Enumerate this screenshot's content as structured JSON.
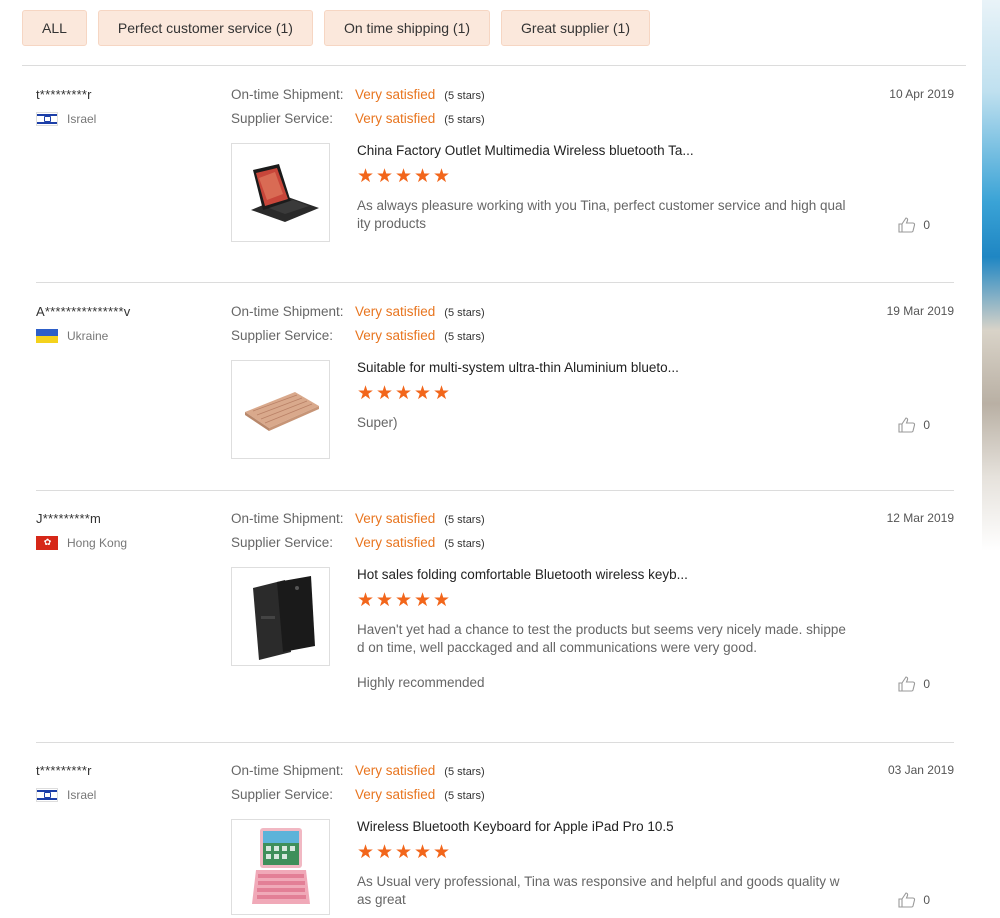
{
  "filters": [
    {
      "label": "ALL"
    },
    {
      "label": "Perfect customer service (1)"
    },
    {
      "label": "On time shipping (1)"
    },
    {
      "label": "Great supplier (1)"
    }
  ],
  "rating_labels": {
    "shipment": "On-time Shipment:",
    "service": "Supplier Service:"
  },
  "colors": {
    "accent": "#e8751f",
    "stars": "#f2661b",
    "filter_bg": "#fbe8dc"
  },
  "reviews": [
    {
      "buyer": "t*********r",
      "country": "Israel",
      "flag": "israel-flag",
      "date": "10 Apr 2019",
      "shipment_value": "Very satisfied",
      "shipment_stars": "(5 stars)",
      "service_value": "Very satisfied",
      "service_stars": "(5 stars)",
      "product_title": "China Factory Outlet Multimedia Wireless bluetooth Ta...",
      "product_image": "tablet-keyboard-case-icon",
      "rating": 5,
      "comment": "As always pleasure working with you Tina, perfect customer service and high quality  products",
      "comment_extra": "",
      "likes": "0"
    },
    {
      "buyer": "A***************v",
      "country": "Ukraine",
      "flag": "ukraine-flag",
      "date": "19 Mar 2019",
      "shipment_value": "Very satisfied",
      "shipment_stars": "(5 stars)",
      "service_value": "Very satisfied",
      "service_stars": "(5 stars)",
      "product_title": "Suitable for multi-system ultra-thin Aluminium blueto...",
      "product_image": "aluminium-keyboard-icon",
      "rating": 5,
      "comment": "Super)",
      "comment_extra": "",
      "likes": "0"
    },
    {
      "buyer": "J*********m",
      "country": "Hong Kong",
      "flag": "hong-kong-flag",
      "date": "12 Mar 2019",
      "shipment_value": "Very satisfied",
      "shipment_stars": "(5 stars)",
      "service_value": "Very satisfied",
      "service_stars": "(5 stars)",
      "product_title": "Hot sales folding comfortable Bluetooth wireless keyb...",
      "product_image": "folio-case-icon",
      "rating": 5,
      "comment": "Haven't yet had a chance to test the products but seems very nicely made. shipped on time, well pacckaged and all communications were very good.",
      "comment_extra": "Highly recommended",
      "likes": "0"
    },
    {
      "buyer": "t*********r",
      "country": "Israel",
      "flag": "israel-flag",
      "date": "03 Jan 2019",
      "shipment_value": "Very satisfied",
      "shipment_stars": "(5 stars)",
      "service_value": "Very satisfied",
      "service_stars": "(5 stars)",
      "product_title": "Wireless Bluetooth Keyboard for Apple iPad Pro 10.5",
      "product_image": "ipad-keyboard-icon",
      "rating": 5,
      "comment": "As Usual very professional, Tina was responsive and helpful and goods quality was great",
      "comment_extra": "",
      "likes": "0"
    }
  ]
}
